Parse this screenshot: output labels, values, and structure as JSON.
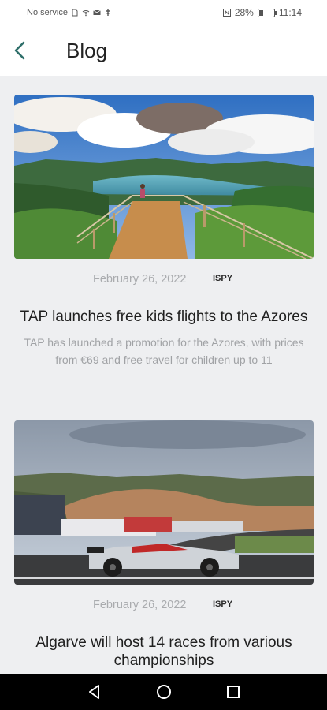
{
  "status_bar": {
    "carrier": "No service",
    "battery_percent": "28%",
    "time": "11:14",
    "battery_level": 0.28
  },
  "header": {
    "title": "Blog",
    "back_icon": "back-arrow-icon"
  },
  "posts": [
    {
      "date": "February 26, 2022",
      "author": "ISPY",
      "title": "TAP launches free kids flights to the Azores",
      "excerpt": "TAP has launched a promotion for the Azores, with prices from €69 and free travel for children up to 11",
      "image": "azores-lake-viewpoint-photo"
    },
    {
      "date": "February 26, 2022",
      "author": "ISPY",
      "title": "Algarve will host 14 races from various championships",
      "excerpt": "",
      "image": "race-car-circuit-photo"
    }
  ],
  "nav_bar": {
    "back": "triangle-back-icon",
    "home": "circle-home-icon",
    "recents": "square-recents-icon"
  },
  "colors": {
    "accent": "#2f6f6a",
    "background": "#eeeff1"
  }
}
